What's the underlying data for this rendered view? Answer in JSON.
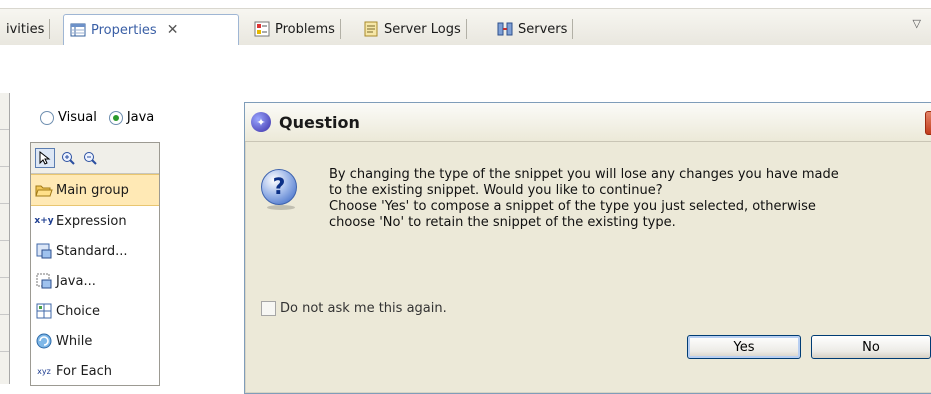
{
  "tabs": {
    "activities": "ivities",
    "properties": "Properties",
    "problems": "Problems",
    "server_logs": "Server Logs",
    "servers": "Servers"
  },
  "editor": {
    "radio_visual": "Visual",
    "radio_java": "Java",
    "selected": "Java"
  },
  "palette": {
    "items": [
      "Main group",
      "Expression",
      "Standard...",
      "Java...",
      "Choice",
      "While",
      "For Each"
    ],
    "selected": "Main group"
  },
  "dialog": {
    "title": "Question",
    "message_line1": "By changing the type of the snippet you will lose any changes you have made",
    "message_line2": "to the existing snippet.  Would you like to continue?",
    "message_line3": "Choose 'Yes' to compose a snippet of the type you just selected, otherwise",
    "message_line4": "choose 'No' to retain the snippet of the existing type.",
    "checkbox_label": "Do not ask me this again.",
    "checkbox_checked": false,
    "yes_label": "Yes",
    "no_label": "No"
  },
  "icons": {
    "properties": "properties-table-icon",
    "problems": "problems-icon",
    "server_logs": "server-logs-icon",
    "servers": "servers-icon",
    "question": "question-icon",
    "close": "close-icon"
  },
  "colors": {
    "dialog_bg": "#ece9d8",
    "close_button": "#c13c1b",
    "selection": "#ffe9b5"
  }
}
